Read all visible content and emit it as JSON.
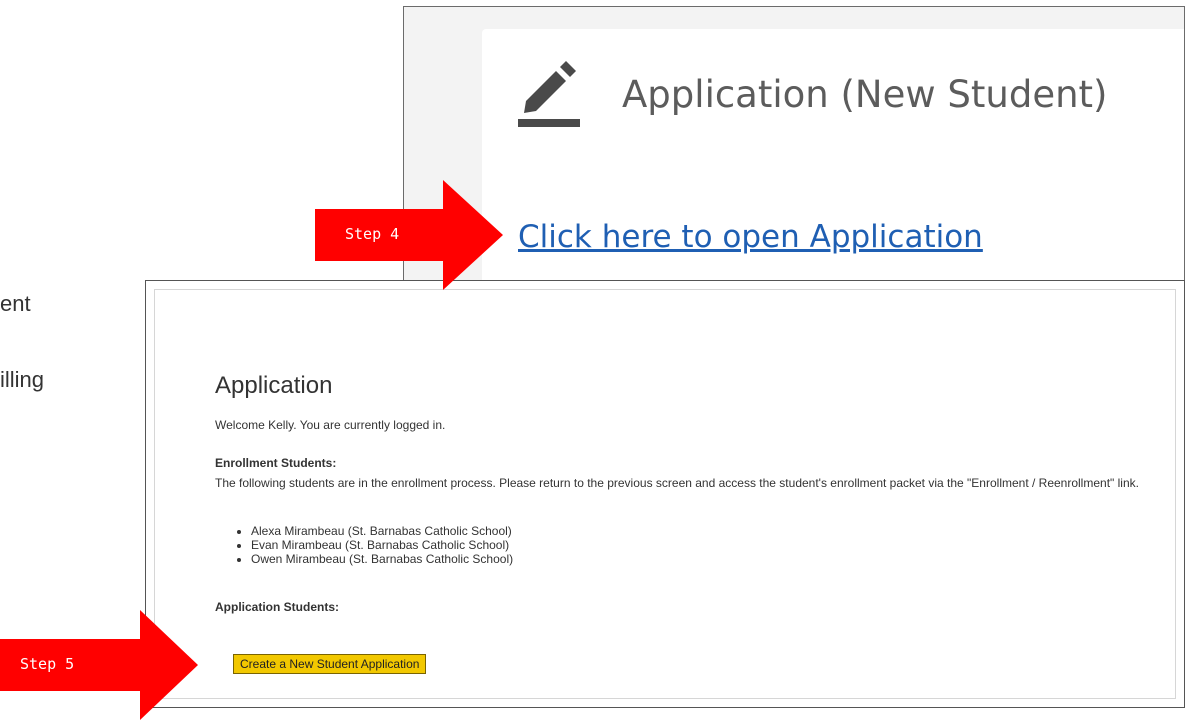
{
  "background_fragments": {
    "line1": "ent",
    "line2": "illing"
  },
  "top_screenshot": {
    "title": "Application (New Student)",
    "link": "Click here to open Application",
    "title_icon": "pencil-icon"
  },
  "bottom_screenshot": {
    "heading": "Application",
    "welcome": "Welcome Kelly. You are currently logged in.",
    "enrollment_heading": "Enrollment Students:",
    "enrollment_text": "The following students are in the enrollment process. Please return to the previous screen and access the student's enrollment packet via the \"Enrollment / Reenrollment\" link.",
    "students": [
      "Alexa Mirambeau (St. Barnabas Catholic School)",
      "Evan Mirambeau (St. Barnabas Catholic School)",
      "Owen Mirambeau (St. Barnabas Catholic School)"
    ],
    "application_heading": "Application Students:",
    "create_button": "Create a New Student Application"
  },
  "annotations": {
    "step4": "Step 4",
    "step5": "Step 5",
    "arrow_color": "#ff0000"
  },
  "colors": {
    "link": "#1f5fb3",
    "button": "#f2c800"
  }
}
